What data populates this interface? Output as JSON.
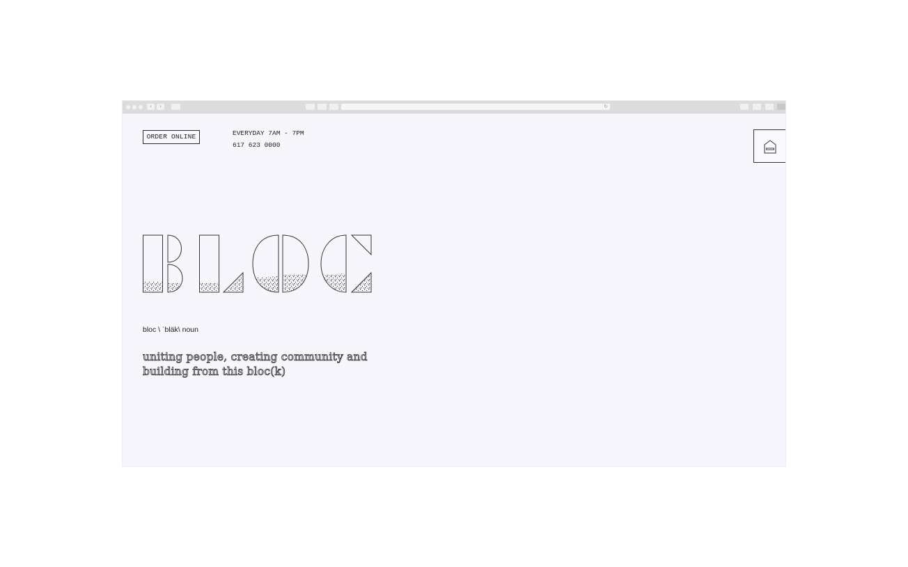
{
  "browser_chrome": {
    "back": "‹",
    "forward": "›",
    "reload": "↻"
  },
  "header": {
    "order_button": "ORDER ONLINE",
    "hours": "EVERYDAY 7AM - 7PM",
    "phone": "617 623 0000"
  },
  "logo": {
    "text": "BLOC"
  },
  "definition": {
    "pronunciation": "bloc \\ ˈbläk\\ noun",
    "tagline_line1": "uniting people, creating community and",
    "tagline_line2": "building from this bloc(k)"
  },
  "colors": {
    "page_bg": "#f7f6fd",
    "ink": "#222222",
    "chrome": "#dcdcdc"
  },
  "icons": [
    "home-icon",
    "share-icon",
    "tabs-icon",
    "sidebar-icon"
  ]
}
